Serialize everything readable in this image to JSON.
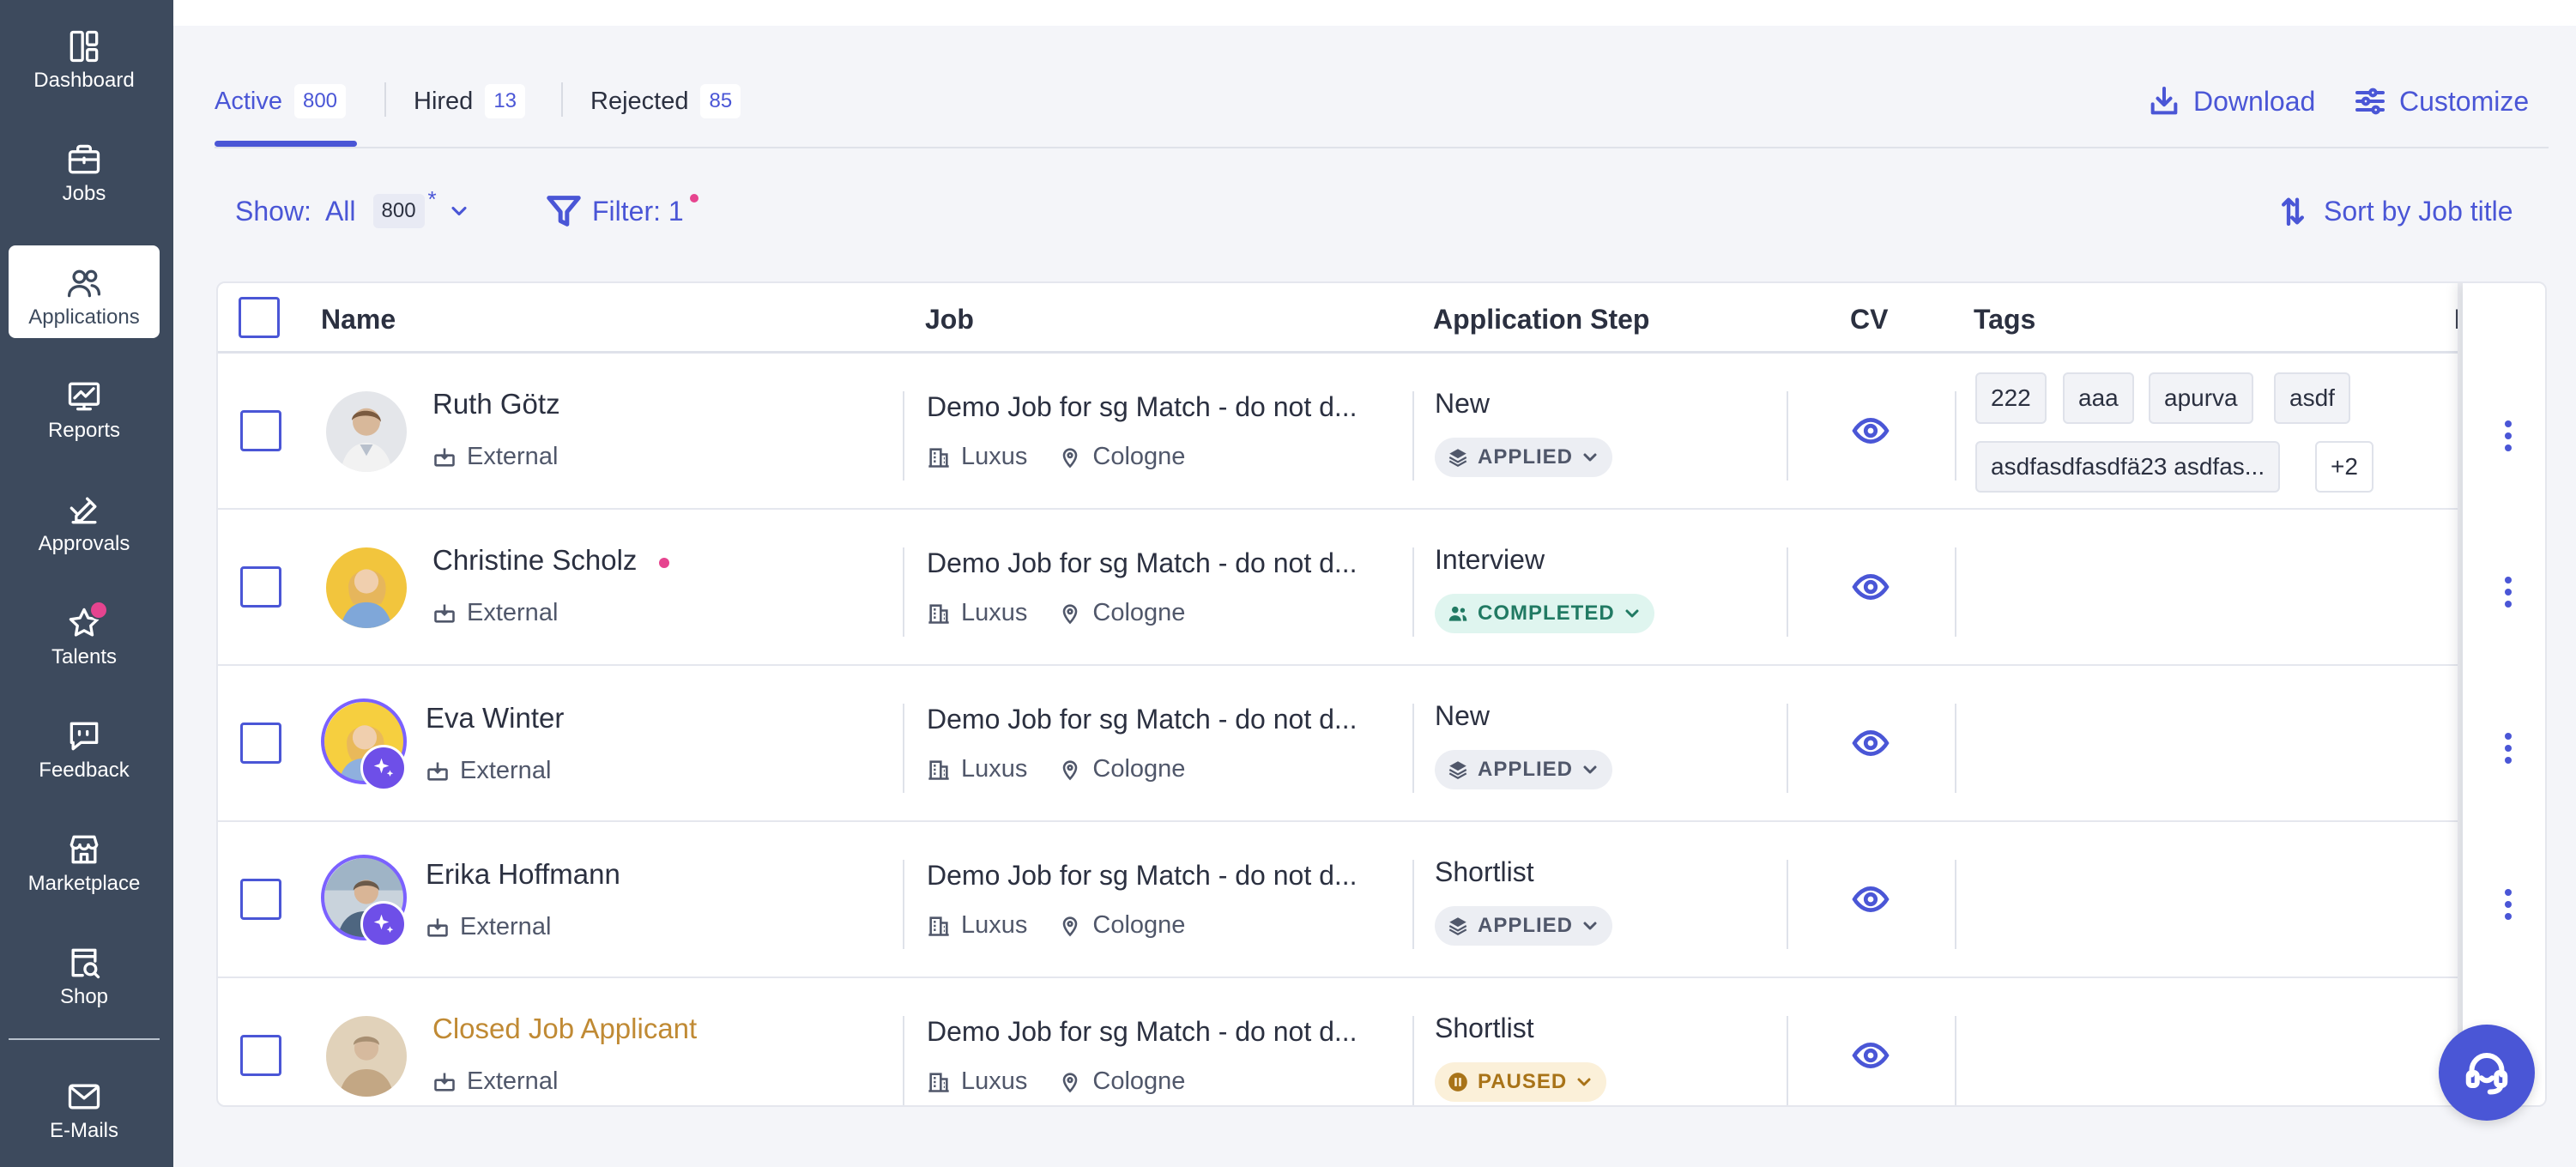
{
  "sidebar": {
    "items": [
      {
        "label": "Dashboard",
        "icon": "dashboard-icon"
      },
      {
        "label": "Jobs",
        "icon": "briefcase-icon"
      },
      {
        "label": "Applications",
        "icon": "users-icon",
        "active": true
      },
      {
        "label": "Reports",
        "icon": "chart-icon"
      },
      {
        "label": "Approvals",
        "icon": "approval-icon"
      },
      {
        "label": "Talents",
        "icon": "star-icon",
        "badge": true
      },
      {
        "label": "Feedback",
        "icon": "feedback-icon"
      },
      {
        "label": "Marketplace",
        "icon": "store-icon"
      },
      {
        "label": "Shop",
        "icon": "shop-search-icon"
      },
      {
        "label": "E-Mails",
        "icon": "mail-icon"
      }
    ]
  },
  "tabs": [
    {
      "label": "Active",
      "count": "800"
    },
    {
      "label": "Hired",
      "count": "13"
    },
    {
      "label": "Rejected",
      "count": "85"
    }
  ],
  "header_actions": {
    "download": "Download",
    "customize": "Customize"
  },
  "toolbar": {
    "show_label": "Show:",
    "show_value": "All",
    "show_count": "800",
    "show_marker": "*",
    "filter_label": "Filter: 1",
    "sort_label": "Sort by Job title"
  },
  "table": {
    "columns": {
      "name": "Name",
      "job": "Job",
      "step": "Application Step",
      "cv": "CV",
      "tags": "Tags",
      "partial": "F"
    },
    "rows": [
      {
        "name": "Ruth Götz",
        "source": "External",
        "job": "Demo Job for sg Match - do not d...",
        "company": "Luxus",
        "city": "Cologne",
        "step": "New",
        "status": "APPLIED",
        "status_type": "applied",
        "tags_row1": [
          "222",
          "aaa",
          "apurva",
          "asdf"
        ],
        "tags_row2": [
          "asdfasdfasdfä23 asdfas...",
          "+2"
        ]
      },
      {
        "name": "Christine Scholz",
        "source": "External",
        "job": "Demo Job for sg Match - do not d...",
        "company": "Luxus",
        "city": "Cologne",
        "step": "Interview",
        "status": "COMPLETED",
        "status_type": "completed",
        "online": true
      },
      {
        "name": "Eva Winter",
        "source": "External",
        "job": "Demo Job for sg Match - do not d...",
        "company": "Luxus",
        "city": "Cologne",
        "step": "New",
        "status": "APPLIED",
        "status_type": "applied",
        "ai": true
      },
      {
        "name": "Erika Hoffmann",
        "source": "External",
        "job": "Demo Job for sg Match - do not d...",
        "company": "Luxus",
        "city": "Cologne",
        "step": "Shortlist",
        "status": "APPLIED",
        "status_type": "applied",
        "ai": true
      },
      {
        "name": "Closed Job Applicant",
        "source": "External",
        "job": "Demo Job for sg Match - do not d...",
        "company": "Luxus",
        "city": "Cologne",
        "step": "Shortlist",
        "status": "PAUSED",
        "status_type": "paused",
        "closed": true
      }
    ]
  },
  "colors": {
    "sidebar": "#3d4a5d",
    "accent": "#4a56d6",
    "badge": "#e6448f",
    "completed": "#217a63",
    "paused": "#a87318",
    "closed_name": "#c08a34"
  }
}
